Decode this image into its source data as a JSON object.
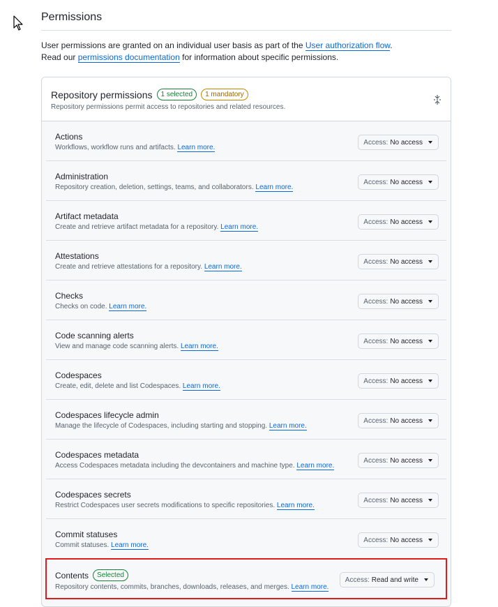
{
  "page": {
    "title": "Permissions",
    "intro_line1_prefix": "User permissions are granted on an individual user basis as part of the ",
    "intro_line1_link": "User authorization flow",
    "intro_line1_suffix": ".",
    "intro_line2_prefix": "Read our ",
    "intro_line2_link": "permissions documentation",
    "intro_line2_suffix": " for information about specific permissions."
  },
  "card": {
    "title": "Repository permissions",
    "badge_selected": "1 selected",
    "badge_mandatory": "1 mandatory",
    "subtitle": "Repository permissions permit access to repositories and related resources."
  },
  "access_label": "Access:",
  "learn_more": "Learn more.",
  "rows": [
    {
      "title": "Actions",
      "desc": "Workflows, workflow runs and artifacts.",
      "value": "No access"
    },
    {
      "title": "Administration",
      "desc": "Repository creation, deletion, settings, teams, and collaborators.",
      "value": "No access"
    },
    {
      "title": "Artifact metadata",
      "desc": "Create and retrieve artifact metadata for a repository.",
      "value": "No access"
    },
    {
      "title": "Attestations",
      "desc": "Create and retrieve attestations for a repository.",
      "value": "No access"
    },
    {
      "title": "Checks",
      "desc": "Checks on code.",
      "value": "No access"
    },
    {
      "title": "Code scanning alerts",
      "desc": "View and manage code scanning alerts.",
      "value": "No access"
    },
    {
      "title": "Codespaces",
      "desc": "Create, edit, delete and list Codespaces.",
      "value": "No access"
    },
    {
      "title": "Codespaces lifecycle admin",
      "desc": "Manage the lifecycle of Codespaces, including starting and stopping.",
      "value": "No access"
    },
    {
      "title": "Codespaces metadata",
      "desc": "Access Codespaces metadata including the devcontainers and machine type.",
      "value": "No access"
    },
    {
      "title": "Codespaces secrets",
      "desc": "Restrict Codespaces user secrets modifications to specific repositories.",
      "value": "No access"
    },
    {
      "title": "Commit statuses",
      "desc": "Commit statuses.",
      "value": "No access"
    },
    {
      "title": "Contents",
      "badge": "Selected",
      "desc": "Repository contents, commits, branches, downloads, releases, and merges.",
      "value": "Read and write"
    }
  ]
}
